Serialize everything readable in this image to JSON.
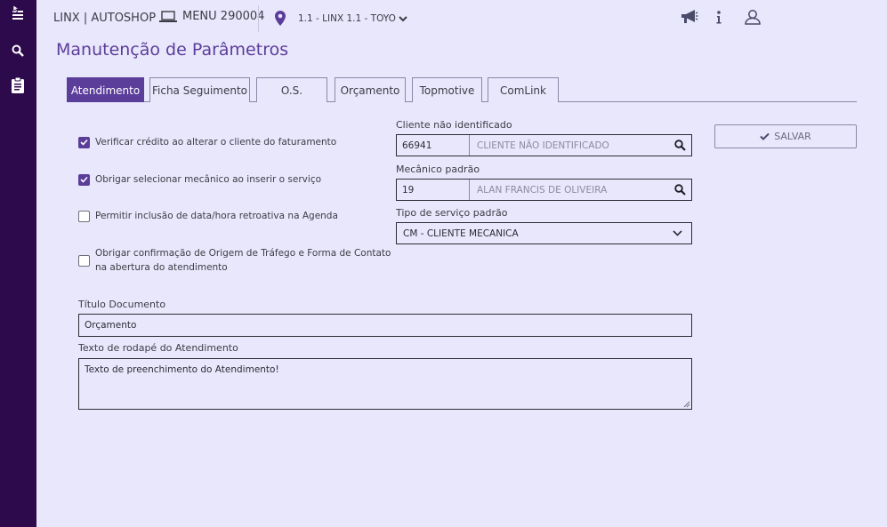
{
  "header": {
    "brand": "LINX | AUTOSHOP",
    "menu_label": "MENU 290004",
    "location": "1.1 - LINX 1.1 - TOYO"
  },
  "page_title": "Manutenção de Parâmetros",
  "tabs": [
    {
      "label": "Atendimento",
      "active": true
    },
    {
      "label": "Ficha Seguimento",
      "active": false
    },
    {
      "label": "O.S.",
      "active": false
    },
    {
      "label": "Orçamento",
      "active": false
    },
    {
      "label": "Topmotive",
      "active": false
    },
    {
      "label": "ComLink",
      "active": false
    }
  ],
  "options": [
    {
      "label": "Verificar crédito ao alterar o cliente do faturamento",
      "checked": true
    },
    {
      "label": "Obrigar selecionar mecânico ao inserir o serviço",
      "checked": true
    },
    {
      "label": "Permitir inclusão de data/hora retroativa na Agenda",
      "checked": false
    },
    {
      "label": "Obrigar confirmação de Origem de Tráfego e Forma de Contato",
      "label2": "na abertura do atendimento",
      "checked": false
    }
  ],
  "cliente": {
    "label": "Cliente não identificado",
    "code": "66941",
    "name": "CLIENTE NÃO IDENTIFICADO"
  },
  "mecanico": {
    "label": "Mecânico padrão",
    "code": "19",
    "name": "ALAN FRANCIS DE OLIVEIRA"
  },
  "tipo_servico": {
    "label": "Tipo de serviço padrão",
    "value": "CM - CLIENTE MECANICA"
  },
  "save_label": "SALVAR",
  "titulo_documento": {
    "label": "Título Documento",
    "value": "Orçamento"
  },
  "texto_rodape": {
    "label": "Texto de rodapé do Atendimento",
    "value": "Texto de preenchimento do Atendimento!"
  },
  "colors": {
    "accent": "#5b3d9a",
    "sidebar": "#2d0a4b",
    "background": "#e9e7fb"
  }
}
